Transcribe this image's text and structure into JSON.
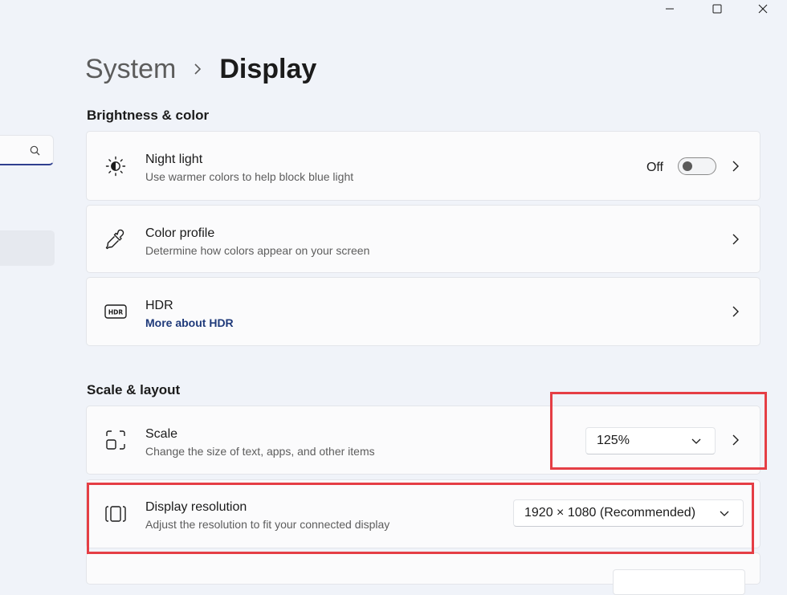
{
  "window": {
    "controls": {
      "minimize_icon": "minimize-icon",
      "maximize_icon": "maximize-icon",
      "close_icon": "close-icon"
    }
  },
  "sidebar": {
    "search": {
      "value": "",
      "icon": "search-icon"
    }
  },
  "breadcrumb": {
    "parent": "System",
    "separator_icon": "chevron-right-icon",
    "current": "Display"
  },
  "sections": {
    "brightness_color": {
      "title": "Brightness & color",
      "night_light": {
        "title": "Night light",
        "description": "Use warmer colors to help block blue light",
        "state_label": "Off",
        "enabled": false,
        "icon": "night-light-icon"
      },
      "color_profile": {
        "title": "Color profile",
        "description": "Determine how colors appear on your screen",
        "icon": "eyedropper-icon"
      },
      "hdr": {
        "title": "HDR",
        "link": "More about HDR",
        "icon": "hdr-icon"
      }
    },
    "scale_layout": {
      "title": "Scale & layout",
      "scale": {
        "title": "Scale",
        "description": "Change the size of text, apps, and other items",
        "value": "125%",
        "icon": "scale-icon"
      },
      "display_resolution": {
        "title": "Display resolution",
        "description": "Adjust the resolution to fit your connected display",
        "value": "1920 × 1080 (Recommended)",
        "icon": "resolution-icon"
      }
    }
  },
  "colors": {
    "background": "#f0f3f9",
    "card": "#fbfbfc",
    "accent": "#2f3f8f",
    "link": "#1f3a7a",
    "highlight": "#e53e45"
  }
}
